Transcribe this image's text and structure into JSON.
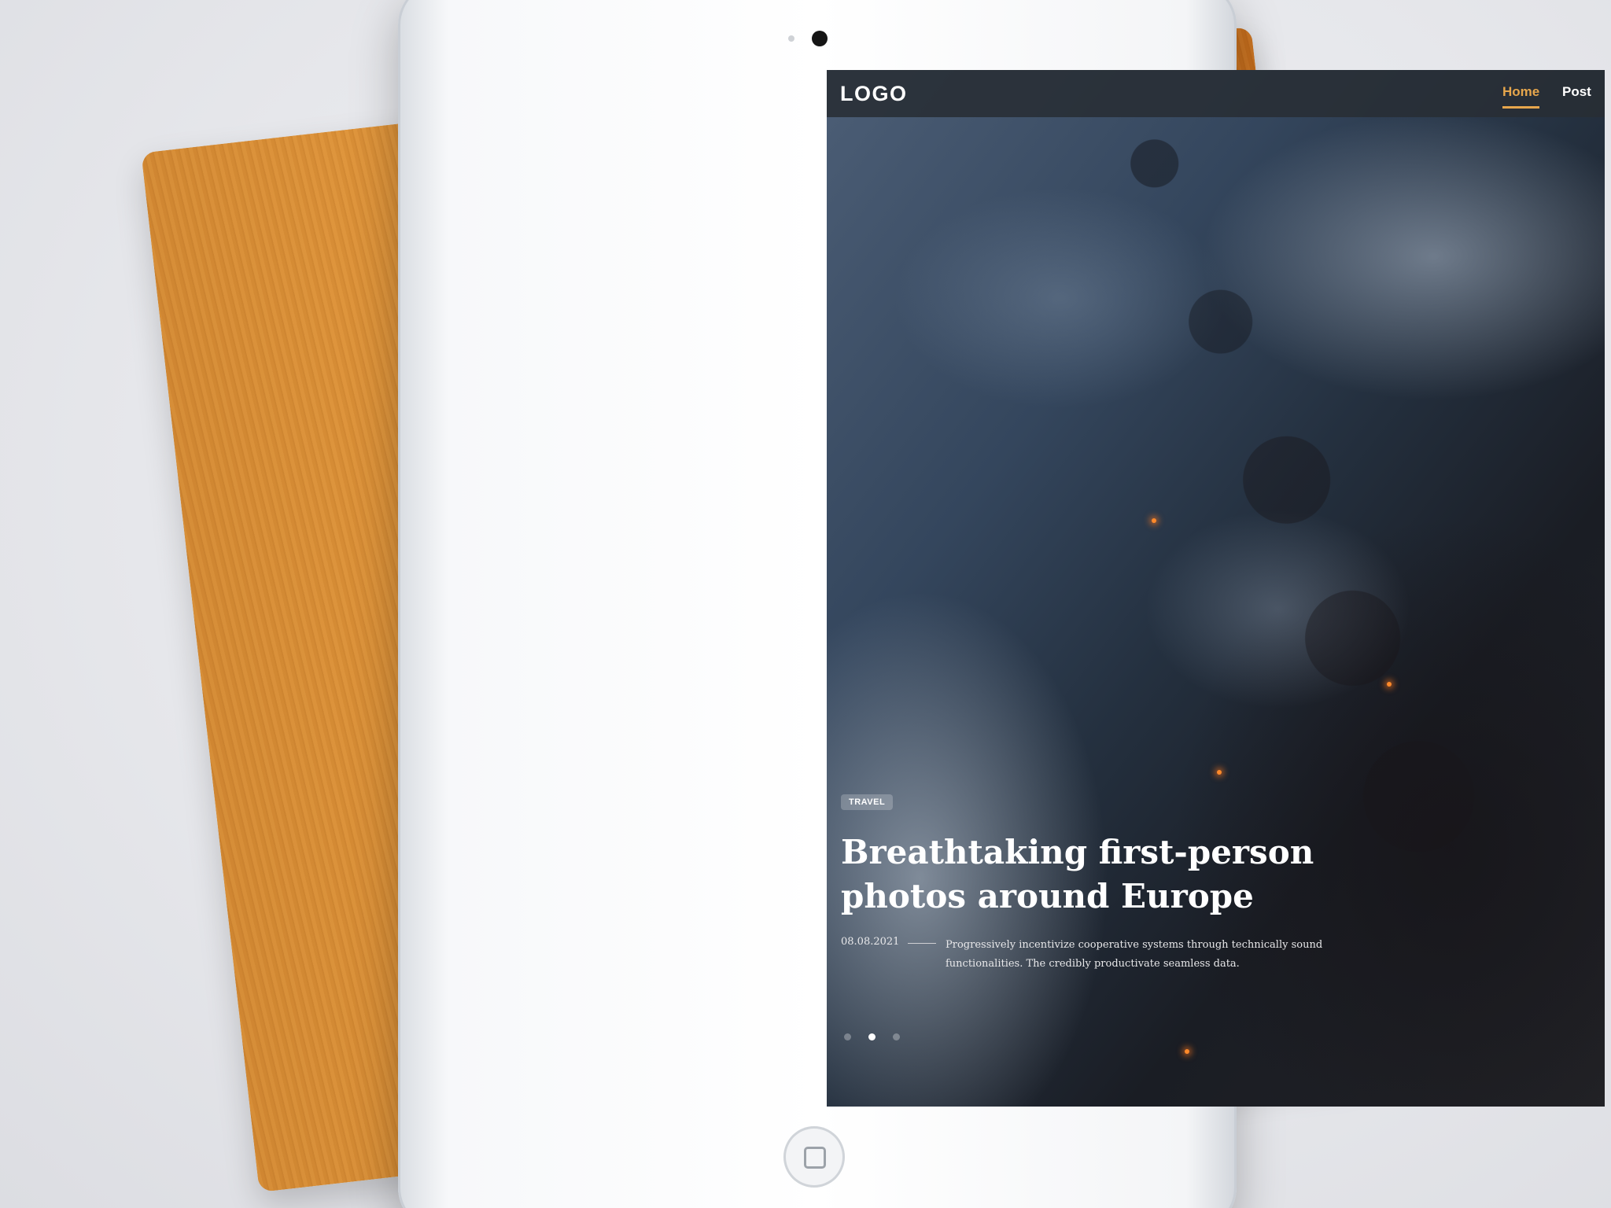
{
  "nav": {
    "logo": "LOGO",
    "links": [
      {
        "label": "Home",
        "active": true
      },
      {
        "label": "Post",
        "active": false
      }
    ],
    "active_color": "#e6a64c"
  },
  "hero": {
    "category": "TRAVEL",
    "title": "Breathtaking first-person photos around Europe",
    "date": "08.08.2021",
    "excerpt": "Progressively incentivize cooperative systems through technically sound functionalities. The credibly productivate seamless data.",
    "slides": {
      "count": 3,
      "active_index": 1
    }
  }
}
